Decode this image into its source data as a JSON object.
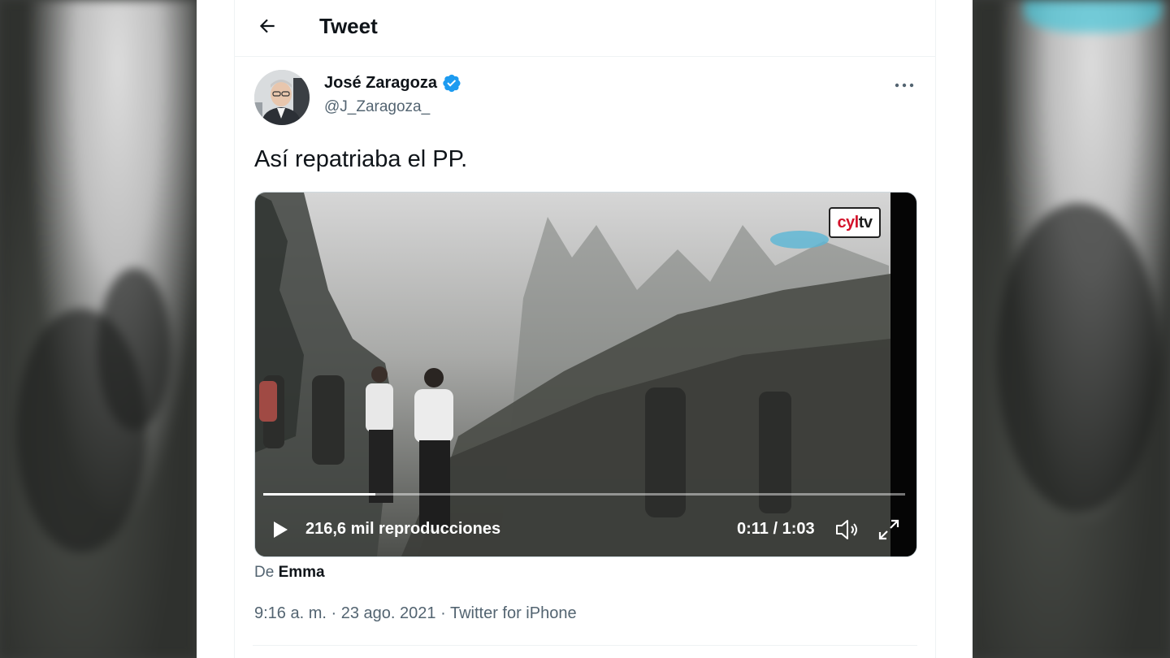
{
  "header": {
    "title": "Tweet"
  },
  "author": {
    "display_name": "José Zaragoza",
    "handle": "@J_Zaragoza_",
    "verified": true
  },
  "tweet": {
    "text": "Así repatriaba el PP."
  },
  "video": {
    "channel_logo": {
      "part1": "cyl",
      "part2": "tv"
    },
    "views": "216,6 mil reproducciones",
    "time": "0:11 / 1:03",
    "progress": 0.175
  },
  "attribution": {
    "prefix": "De",
    "name": "Emma"
  },
  "meta": {
    "time": "9:16 a. m.",
    "sep1": "·",
    "date": "23 ago. 2021",
    "sep2": "·",
    "source": "Twitter for iPhone"
  },
  "colors": {
    "verified_badge": "#1d9bf0",
    "text_primary": "#0f1419",
    "text_secondary": "#536471"
  }
}
